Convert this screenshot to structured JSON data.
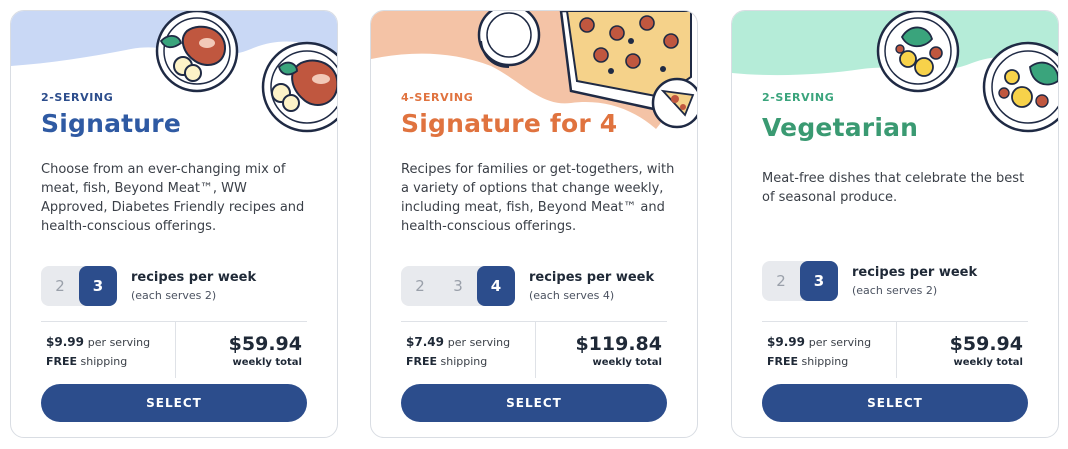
{
  "accent": "#2c4d8c",
  "cards": [
    {
      "serving": "2-SERVING",
      "serving_color": "#2c4d8c",
      "title": "Signature",
      "title_color": "#2f5aa3",
      "description": "Choose from an ever-changing mix of meat, fish, Beyond Meat™, WW Approved, Diabetes Friendly recipes and health-conscious offerings.",
      "steps": [
        "2",
        "3"
      ],
      "selected_step": "3",
      "recipes_label": "recipes per week",
      "serves_label": "(each serves 2)",
      "price_per_serving": "$9.99",
      "per_serving_label": "per serving",
      "shipping_free": "FREE",
      "shipping_label": "shipping",
      "total": "$59.94",
      "total_label": "weekly total",
      "button": "SELECT",
      "illustration": "steak-plate-icon"
    },
    {
      "serving": "4-SERVING",
      "serving_color": "#e0733f",
      "title": "Signature for 4",
      "title_color": "#e0733f",
      "description": "Recipes for families or get-togethers, with a variety of options that change weekly, including meat, fish, Beyond Meat™ and health-conscious offerings.",
      "steps": [
        "2",
        "3",
        "4"
      ],
      "selected_step": "4",
      "recipes_label": "recipes per week",
      "serves_label": "(each serves 4)",
      "price_per_serving": "$7.49",
      "per_serving_label": "per serving",
      "shipping_free": "FREE",
      "shipping_label": "shipping",
      "total": "$119.84",
      "total_label": "weekly total",
      "button": "SELECT",
      "illustration": "pizza-icon"
    },
    {
      "serving": "2-SERVING",
      "serving_color": "#3aa47c",
      "title": "Vegetarian",
      "title_color": "#3a9a72",
      "description": "Meat-free dishes that celebrate the best of seasonal produce.",
      "steps": [
        "2",
        "3"
      ],
      "selected_step": "3",
      "recipes_label": "recipes per week",
      "serves_label": "(each serves 2)",
      "price_per_serving": "$9.99",
      "per_serving_label": "per serving",
      "shipping_free": "FREE",
      "shipping_label": "shipping",
      "total": "$59.94",
      "total_label": "weekly total",
      "button": "SELECT",
      "illustration": "salad-plate-icon"
    }
  ]
}
